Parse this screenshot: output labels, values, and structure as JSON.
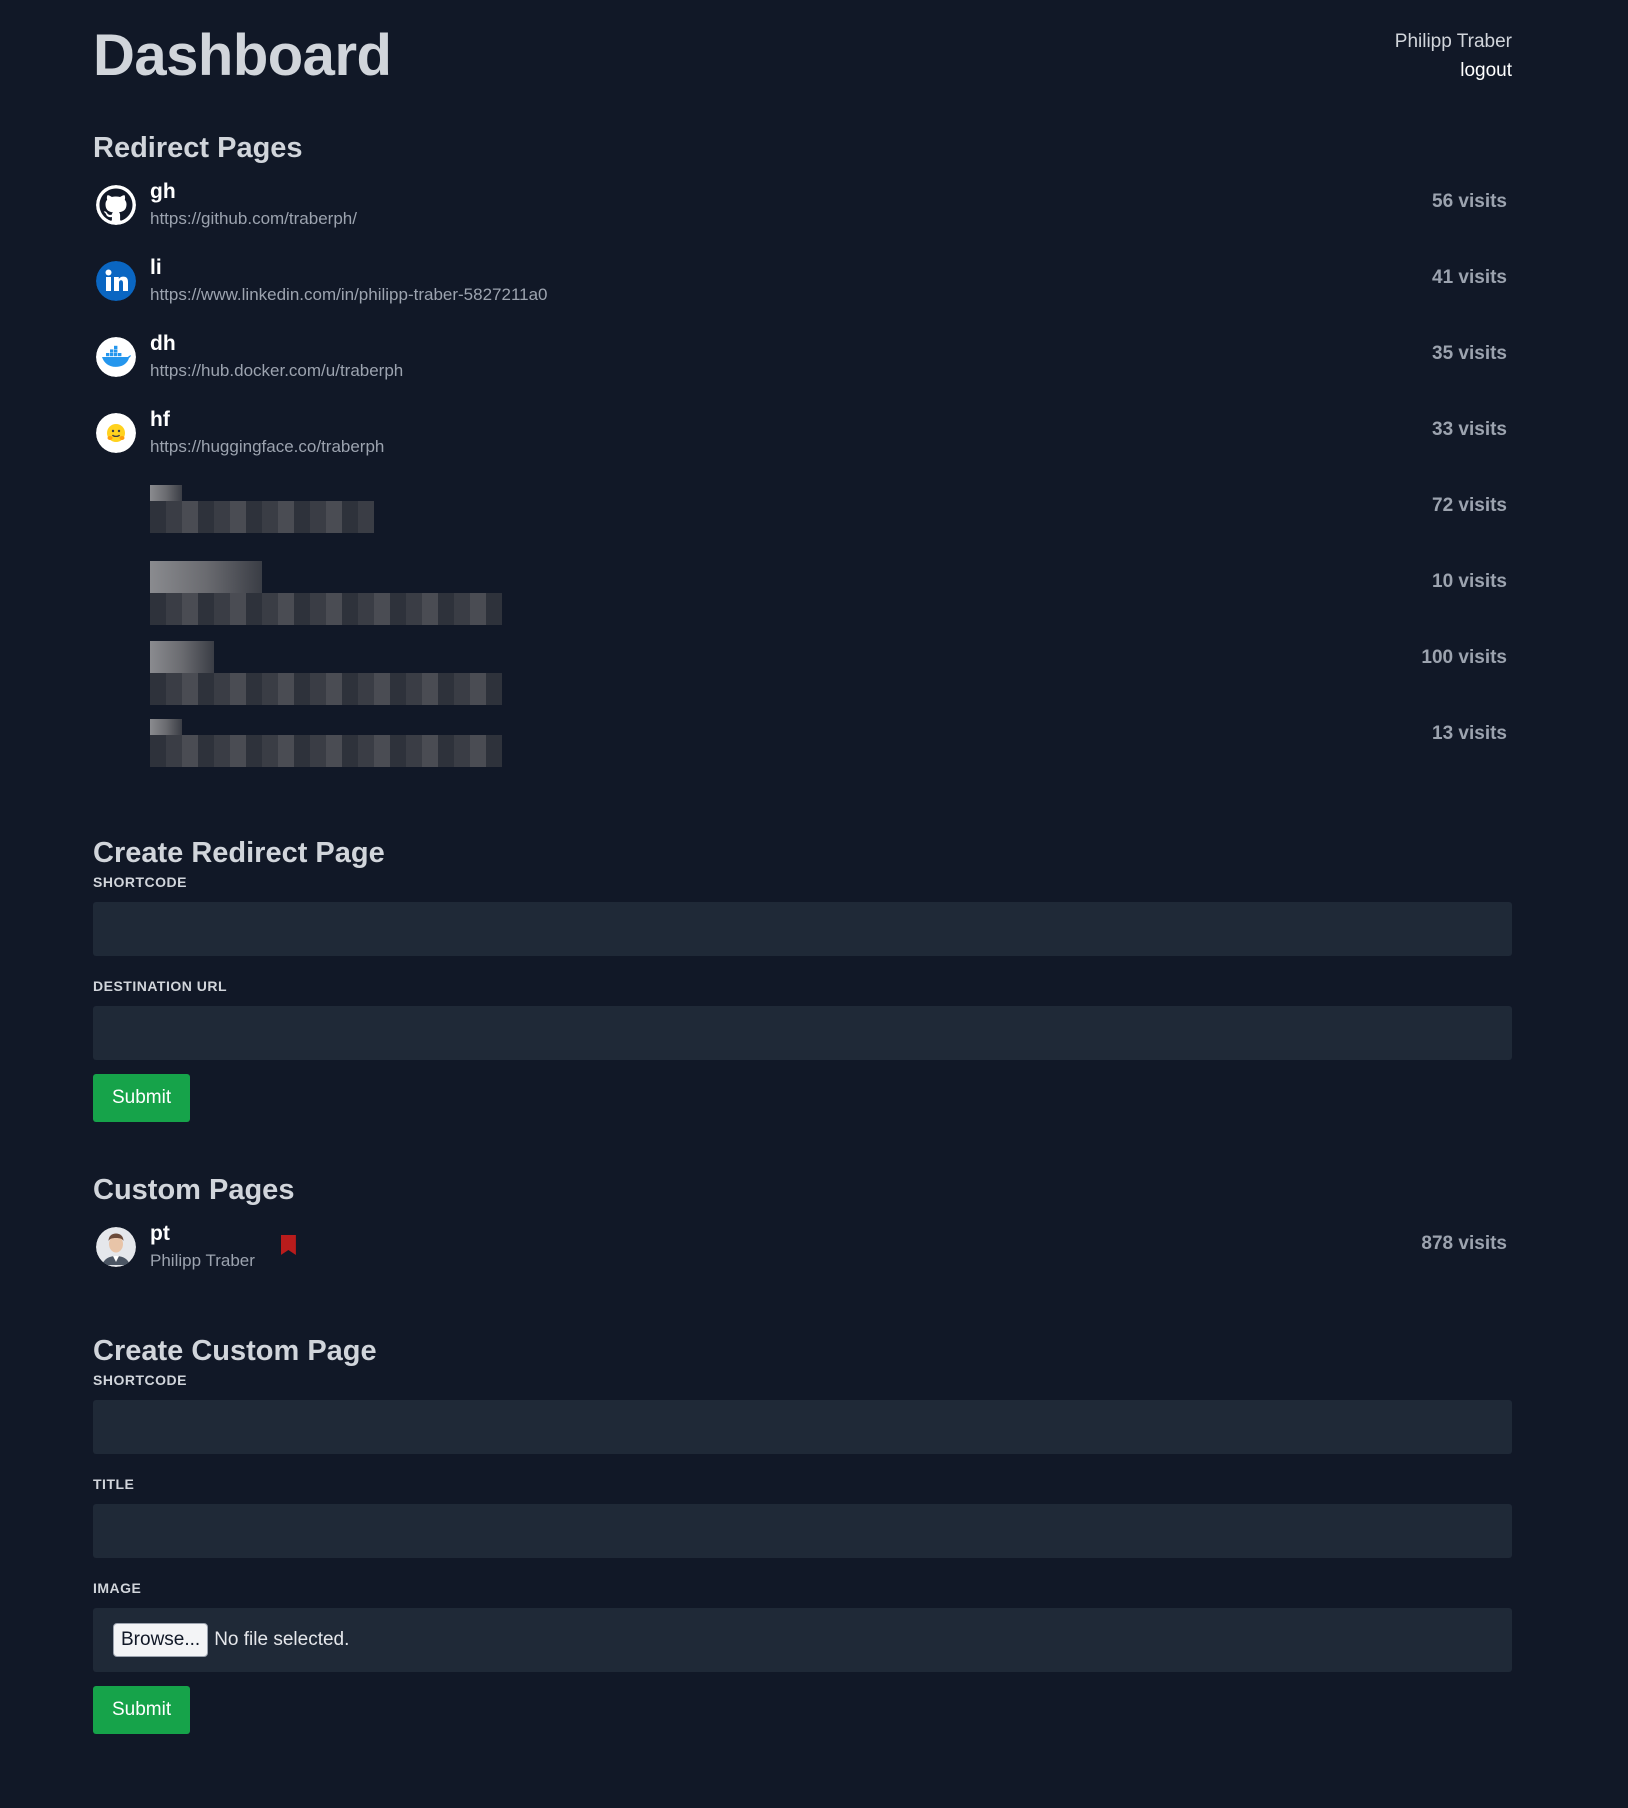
{
  "header": {
    "title": "Dashboard",
    "user_name": "Philipp Traber",
    "logout_label": "logout"
  },
  "redirect": {
    "heading": "Redirect Pages",
    "items": [
      {
        "code": "gh",
        "url": "https://github.com/traberph/",
        "visits": "56 visits",
        "icon": "github-icon"
      },
      {
        "code": "li",
        "url": "https://www.linkedin.com/in/philipp-traber-5827211a0",
        "visits": "41 visits",
        "icon": "linkedin-icon"
      },
      {
        "code": "dh",
        "url": "https://hub.docker.com/u/traberph",
        "visits": "35 visits",
        "icon": "docker-icon"
      },
      {
        "code": "hf",
        "url": "https://huggingface.co/traberph",
        "visits": "33 visits",
        "icon": "huggingface-icon"
      }
    ],
    "hidden_items": [
      {
        "visits": "72 visits"
      },
      {
        "visits": "10 visits"
      },
      {
        "visits": "100 visits"
      },
      {
        "visits": "13 visits"
      }
    ]
  },
  "create_redirect": {
    "heading": "Create Redirect Page",
    "shortcode_label": "SHORTCODE",
    "destination_label": "DESTINATION URL",
    "submit_label": "Submit"
  },
  "custom": {
    "heading": "Custom Pages",
    "items": [
      {
        "code": "pt",
        "title": "Philipp Traber",
        "visits": "878 visits",
        "icon": "avatar"
      }
    ]
  },
  "create_custom": {
    "heading": "Create Custom Page",
    "shortcode_label": "SHORTCODE",
    "title_label": "TITLE",
    "image_label": "IMAGE",
    "browse_label": "Browse...",
    "file_status": "No file selected.",
    "submit_label": "Submit"
  },
  "colors": {
    "background": "#111827",
    "input": "#1f2937",
    "submit": "#16a34a",
    "bookmark": "#b91c1c"
  }
}
